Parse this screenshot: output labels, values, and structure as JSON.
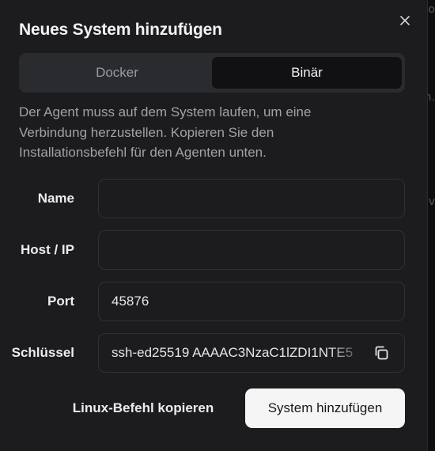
{
  "background": {
    "fragments": [
      "o",
      "n.",
      "v"
    ]
  },
  "dialog": {
    "title": "Neues System hinzufügen",
    "close_icon": "close-icon",
    "tabs": [
      {
        "label": "Docker",
        "selected": false
      },
      {
        "label": "Binär",
        "selected": true
      }
    ],
    "description": "Der Agent muss auf dem System laufen, um eine Verbindung herzustellen. Kopieren Sie den Installationsbefehl für den Agenten unten.",
    "fields": {
      "name": {
        "label": "Name",
        "value": ""
      },
      "host": {
        "label": "Host / IP",
        "value": ""
      },
      "port": {
        "label": "Port",
        "value": "45876"
      },
      "key": {
        "label": "Schlüssel",
        "value": "ssh-ed25519 AAAAC3NzaC1lZDI1NTE5",
        "copy_icon": "copy-icon"
      }
    },
    "buttons": {
      "copy_linux": "Linux-Befehl kopieren",
      "add_system": "System hinzufügen"
    }
  },
  "colors": {
    "dialog_bg": "#1c1c1f",
    "primary_button_bg": "#f5f5f6",
    "selected_tab_bg": "#111113"
  }
}
